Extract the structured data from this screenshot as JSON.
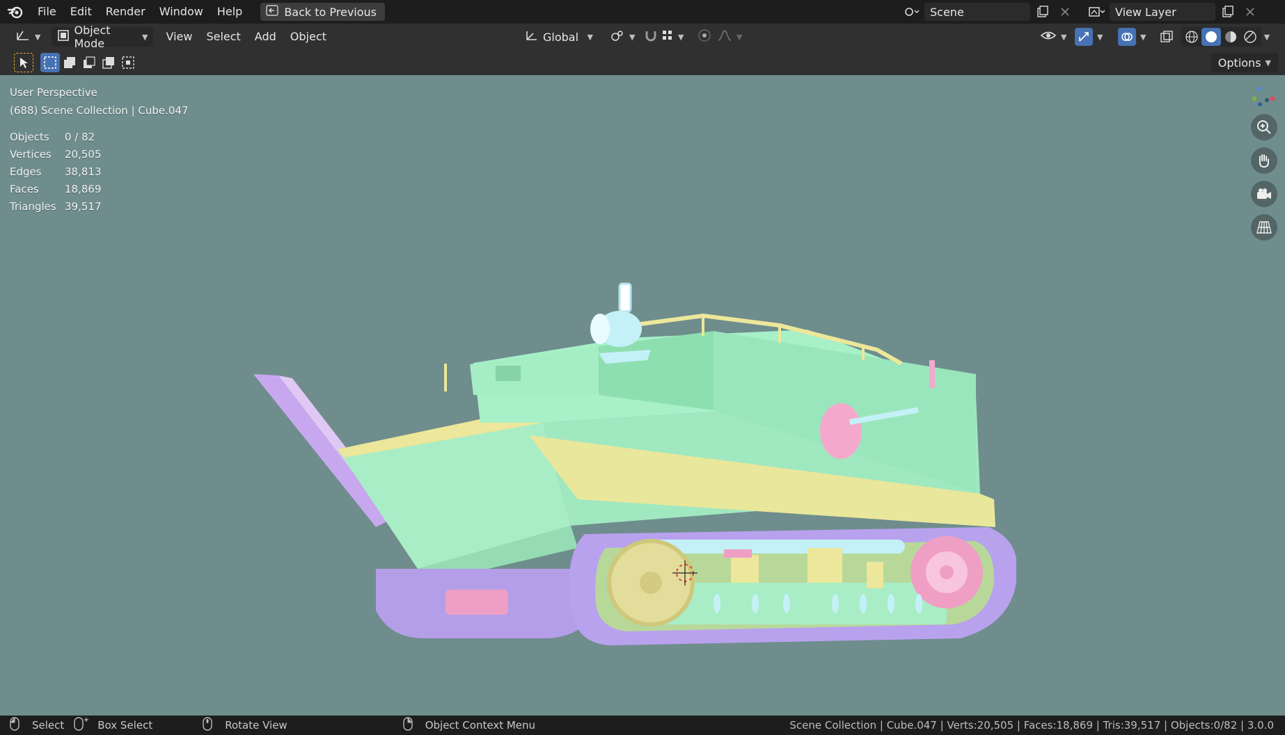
{
  "menubar": {
    "items": [
      "File",
      "Edit",
      "Render",
      "Window",
      "Help"
    ],
    "back_label": "Back to Previous",
    "scene_name": "Scene",
    "view_layer": "View Layer"
  },
  "header": {
    "mode": "Object Mode",
    "menus": [
      "View",
      "Select",
      "Add",
      "Object"
    ],
    "orientation": "Global"
  },
  "toolrow": {
    "options_label": "Options"
  },
  "viewport": {
    "perspective": "User Perspective",
    "collection_line": "(688) Scene Collection | Cube.047",
    "stats": [
      {
        "label": "Objects",
        "value": "0 / 82"
      },
      {
        "label": "Vertices",
        "value": "20,505"
      },
      {
        "label": "Edges",
        "value": "38,813"
      },
      {
        "label": "Faces",
        "value": "18,869"
      },
      {
        "label": "Triangles",
        "value": "39,517"
      }
    ],
    "background_color": "#6f8d8d"
  },
  "statusbar": {
    "select": "Select",
    "box_select": "Box Select",
    "rotate_view": "Rotate View",
    "context_menu": "Object Context Menu",
    "summary": "Scene Collection | Cube.047 | Verts:20,505 | Faces:18,869 | Tris:39,517 | Objects:0/82 | 3.0.0"
  },
  "colors": {
    "accent": "#4772b3",
    "hull_green": "#9fe8c0",
    "hull_yellow": "#ece79a",
    "track_purple": "#b8a2ee",
    "pink": "#ef9fc4"
  }
}
